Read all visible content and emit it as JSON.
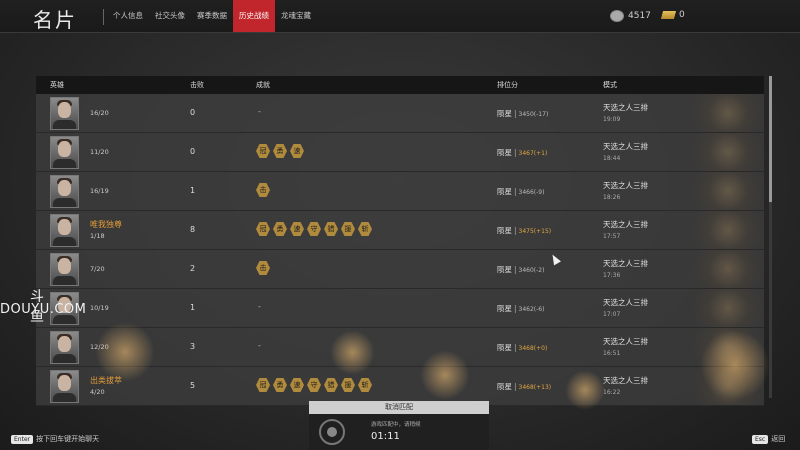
{
  "header": {
    "title": "名片",
    "tabs": [
      {
        "label": "个人信息",
        "active": false
      },
      {
        "label": "社交头像",
        "active": false
      },
      {
        "label": "赛季数据",
        "active": false
      },
      {
        "label": "历史战绩",
        "active": true
      },
      {
        "label": "龙魂宝藏",
        "active": false
      }
    ],
    "currency_silver": "4517",
    "currency_gold": "0"
  },
  "table": {
    "headers": {
      "hero": "英雄",
      "kills": "击败",
      "achievements": "成就",
      "rank": "排位分",
      "mode": "模式"
    },
    "rows": [
      {
        "name": "",
        "rank": "16/20",
        "kills": "0",
        "achievements": [],
        "tier": "陨星",
        "score": "3450(-17)",
        "score_positive": false,
        "mode": "天选之人三排",
        "time": "19:09"
      },
      {
        "name": "",
        "rank": "11/20",
        "kills": "0",
        "achievements": [
          "冠",
          "勇",
          "速"
        ],
        "tier": "陨星",
        "score": "3467(+1)",
        "score_positive": true,
        "mode": "天选之人三排",
        "time": "18:44"
      },
      {
        "name": "",
        "rank": "16/19",
        "kills": "1",
        "achievements": [
          "击"
        ],
        "tier": "陨星",
        "score": "3466(-9)",
        "score_positive": false,
        "mode": "天选之人三排",
        "time": "18:26"
      },
      {
        "name": "唯我独尊",
        "rank": "1/18",
        "kills": "8",
        "achievements": [
          "冠",
          "勇",
          "速",
          "守",
          "猎",
          "援",
          "斩"
        ],
        "tier": "陨星",
        "score": "3475(+15)",
        "score_positive": true,
        "mode": "天选之人三排",
        "time": "17:57"
      },
      {
        "name": "",
        "rank": "7/20",
        "kills": "2",
        "achievements": [
          "击"
        ],
        "tier": "陨星",
        "score": "3460(-2)",
        "score_positive": false,
        "mode": "天选之人三排",
        "time": "17:36"
      },
      {
        "name": "",
        "rank": "10/19",
        "kills": "1",
        "achievements": [],
        "tier": "陨星",
        "score": "3462(-6)",
        "score_positive": false,
        "mode": "天选之人三排",
        "time": "17:07"
      },
      {
        "name": "",
        "rank": "12/20",
        "kills": "3",
        "achievements": [],
        "tier": "陨星",
        "score": "3468(+0)",
        "score_positive": true,
        "mode": "天选之人三排",
        "time": "16:51"
      },
      {
        "name": "出类拔萃",
        "rank": "4/20",
        "kills": "5",
        "achievements": [
          "冠",
          "勇",
          "速",
          "守",
          "猎",
          "援",
          "斩"
        ],
        "tier": "陨星",
        "score": "3468(+13)",
        "score_positive": true,
        "mode": "天选之人三排",
        "time": "16:22"
      }
    ]
  },
  "matchmaking": {
    "cancel_label": "取消匹配",
    "status": "游戏匹配中，请稍候",
    "timer": "01:11"
  },
  "hints": {
    "enter_key": "Enter",
    "enter_text": "按下回车键开始聊天",
    "esc_key": "Esc",
    "esc_text": "返回"
  },
  "watermark": {
    "cn": "斗鱼",
    "en": "DOUYU.COM"
  },
  "colors": {
    "accent": "#c0262b",
    "gold_text": "#e0a640",
    "achievement": "#b08a3d"
  }
}
